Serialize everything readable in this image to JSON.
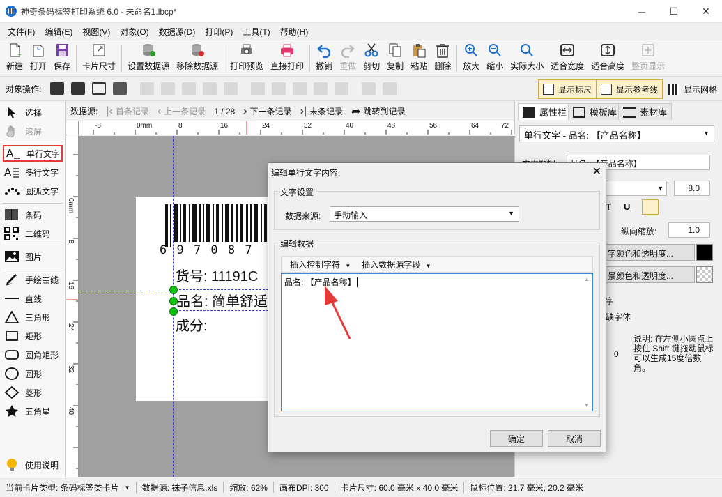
{
  "window": {
    "title": "神奇条码标签打印系统 6.0 - 未命名1.lbcp*",
    "minimize": "─",
    "maximize": "☐",
    "close": "✕"
  },
  "menu": [
    "文件(F)",
    "编辑(E)",
    "视图(V)",
    "对象(O)",
    "数据源(D)",
    "打印(P)",
    "工具(T)",
    "帮助(H)"
  ],
  "toolbar": {
    "new": "新建",
    "open": "打开",
    "save": "保存",
    "card_size": "卡片尺寸",
    "set_datasource": "设置数据源",
    "remove_datasource": "移除数据源",
    "print_preview": "打印预览",
    "direct_print": "直接打印",
    "undo": "撤销",
    "redo": "重做",
    "cut": "剪切",
    "copy": "复制",
    "paste": "粘贴",
    "delete": "删除",
    "zoom_in": "放大",
    "zoom_out": "缩小",
    "actual_size": "实际大小",
    "fit_width": "适合宽度",
    "fit_height": "适合高度",
    "full_page": "整页显示"
  },
  "ops": {
    "label": "对象操作:",
    "show_ruler": "显示标尺",
    "show_guides": "显示参考线",
    "show_grid": "显示网格"
  },
  "tools": {
    "select": "选择",
    "scroll": "滚屏",
    "single_text": "单行文字",
    "multi_text": "多行文字",
    "arc_text": "圆弧文字",
    "barcode": "条码",
    "qrcode": "二维码",
    "image": "图片",
    "freehand": "手绘曲线",
    "line": "直线",
    "triangle": "三角形",
    "rect": "矩形",
    "round_rect": "圆角矩形",
    "circle": "圆形",
    "diamond": "菱形",
    "star": "五角星",
    "help": "使用说明"
  },
  "nav": {
    "label": "数据源:",
    "first": "首条记录",
    "prev": "上一条记录",
    "position": "1 / 28",
    "next": "下一条记录",
    "last": "末条记录",
    "goto": "跳转到记录"
  },
  "ruler": {
    "top": [
      "-8",
      "0mm",
      "8",
      "16",
      "24",
      "32",
      "40",
      "48",
      "56",
      "64",
      "72"
    ],
    "left": [
      "0mm",
      "8",
      "16",
      "24",
      "32",
      "40"
    ]
  },
  "label": {
    "barcode_digits": "6 9 7 0 8 7",
    "line1": "货号: 11191C",
    "line2": "品名: 简单舒适",
    "line3": "成分:"
  },
  "right_panel": {
    "tab_props": "属性栏",
    "tab_templates": "模板库",
    "tab_assets": "素材库",
    "object": "单行文字 - 品名: 【产品名称】",
    "text_data_label": "文本数据:",
    "text_data_value": "品名: 【产品名称】",
    "font_size": "8.0",
    "vscale_label": "纵向缩放:",
    "vscale_value": "1.0",
    "text_color_btn": "字颜色和透明度...",
    "bg_color_btn": "景颜色和透明度...",
    "char_label": "字",
    "font_label": "缺字体",
    "rotation": "0",
    "note": "说明: 在左侧小圆点上按住 Shift 键拖动鼠标可以生成15度倍数角。"
  },
  "status": {
    "card_type": "当前卡片类型: 条码标签类卡片",
    "datasource": "数据源: 袜子信息.xls",
    "zoom": "缩放: 62%",
    "dpi": "画布DPI: 300",
    "card_size": "卡片尺寸: 60.0 毫米 x 40.0 毫米",
    "mouse": "鼠标位置: 21.7 毫米, 20.2 毫米"
  },
  "dialog": {
    "title": "编辑单行文字内容:",
    "text_settings": "文字设置",
    "source_label": "数据来源:",
    "source_value": "手动输入",
    "edit_data": "编辑数据",
    "insert_control": "插入控制字符",
    "insert_field": "插入数据源字段",
    "content": "品名: 【产品名称】",
    "ok": "确定",
    "cancel": "取消"
  },
  "colors": {
    "accent": "#1a6fd0",
    "selected_border": "#e23b3b",
    "handle": "#13c113",
    "annotation_arrow": "#e53935"
  }
}
